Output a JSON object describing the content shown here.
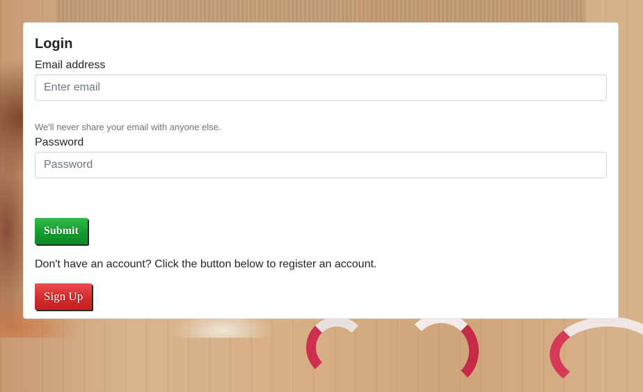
{
  "form": {
    "title": "Login",
    "email_label": "Email address",
    "email_placeholder": "Enter email",
    "email_value": "",
    "email_help": "We'll never share your email with anyone else.",
    "password_label": "Password",
    "password_placeholder": "Password",
    "password_value": "",
    "submit_label": "Submit",
    "register_note": "Don't have an account? Click the button below to register an account.",
    "signup_label": "Sign Up"
  },
  "colors": {
    "submit_button": "#139c2f",
    "signup_button": "#d32c2c",
    "card_background": "#ffffff"
  }
}
